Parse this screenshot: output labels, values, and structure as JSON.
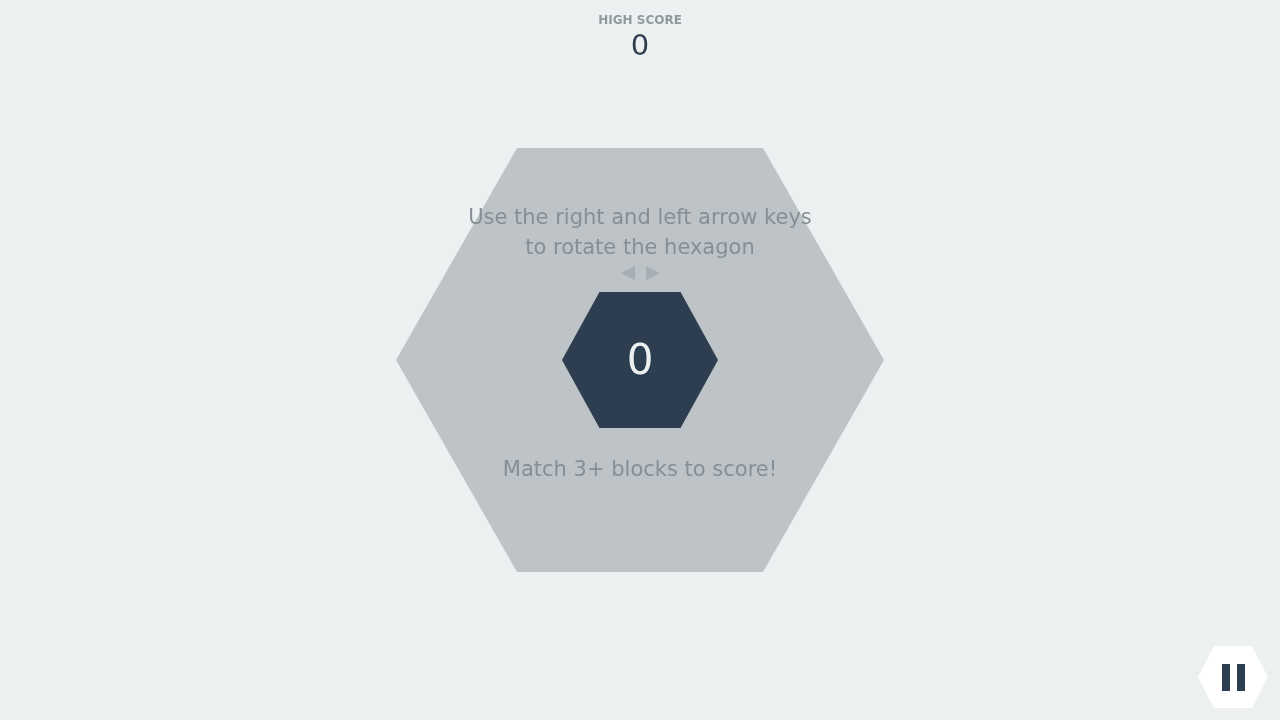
{
  "high_score": {
    "label": "HIGH SCORE",
    "value": "0"
  },
  "board": {
    "instructions": [
      "Use the right and left arrow keys",
      "to rotate the hexagon"
    ],
    "score": "0",
    "hint": "Match 3+ blocks to score!"
  }
}
